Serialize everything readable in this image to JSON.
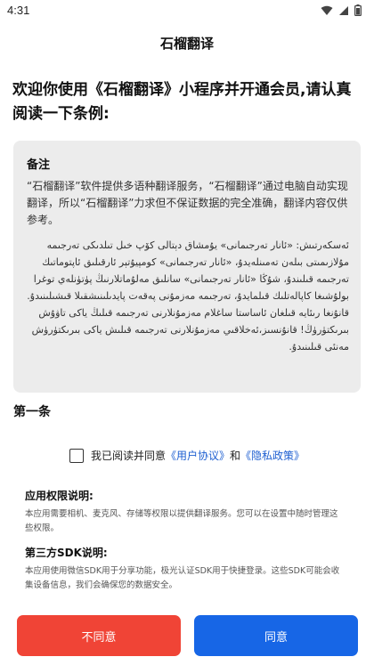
{
  "status": {
    "time": "4:31"
  },
  "nav": {
    "title": "石榴翻译"
  },
  "welcome": "欢迎你使用《石榴翻译》小程序并开通会员,请认真阅读一下条例:",
  "notice": {
    "heading": "备注",
    "text_cn": "“石榴翻译”软件提供多语种翻译服务，“石榴翻译”通过电脑自动实现翻译，所以“石榴翻译”力求但不保证数据的完全准确，翻译内容仅供参考。",
    "text_ug": "ئەسكەرتىش: «ئانار تەرجىمانى» يۇمشاق دېتالى كۆپ خىل تىلدىكى تەرجىمە مۇلازىمىتى بىلەن تەمىنلەيدۇ، «ئانار تەرجىمانى» كومپيۇتېر ئارقىلىق ئاپتوماتىك تەرجىمە قىلىندۇ، شۇڭا «ئانار تەرجىمانى» سانلىق مەلۇماتلارنىڭ پۈتۈنلەي توغرا بولۇشىغا كاپالەتلىك قىلمايدۇ، تەرجىمە مەزمۇنى پەقەت پايدىلىنىشقىلا قىشىلىنىدۇ. قانۇنغا رىئايە قىلغان ئاساستا ساغلام مەزمۇنلارنى تەرجىمە قىلىڭ ياكى تاۋۇش بىرىكتۈرۈڭ! قانۇنسىز،ئەخلاقىي مەزمۇنلارنى تەرجىمە قىلىش ياكى بىرىكتۈرۈش مەنئى قىلىنىدۇ."
  },
  "article_title": "第一条",
  "agree": {
    "prefix": "我已阅读并同意",
    "user_agreement": "《用户协议》",
    "and": "和",
    "privacy_policy": "《隐私政策》"
  },
  "permissions": {
    "title": "应用权限说明:",
    "text": "本应用需要相机、麦克风、存储等权限以提供翻译服务。您可以在设置中随时管理这些权限。"
  },
  "sdk": {
    "title": "第三方SDK说明:",
    "text": "本应用使用微信SDK用于分享功能，极光认证SDK用于快捷登录。这些SDK可能会收集设备信息，我们会确保您的数据安全。"
  },
  "buttons": {
    "disagree": "不同意",
    "agree": "同意"
  },
  "colors": {
    "disagree": "#f04436",
    "agree": "#1766e6",
    "link": "#1e5fd1",
    "notice_bg": "#ececec"
  },
  "icons": {
    "wifi": "wifi-icon",
    "signal": "signal-icon",
    "battery": "battery-icon"
  }
}
